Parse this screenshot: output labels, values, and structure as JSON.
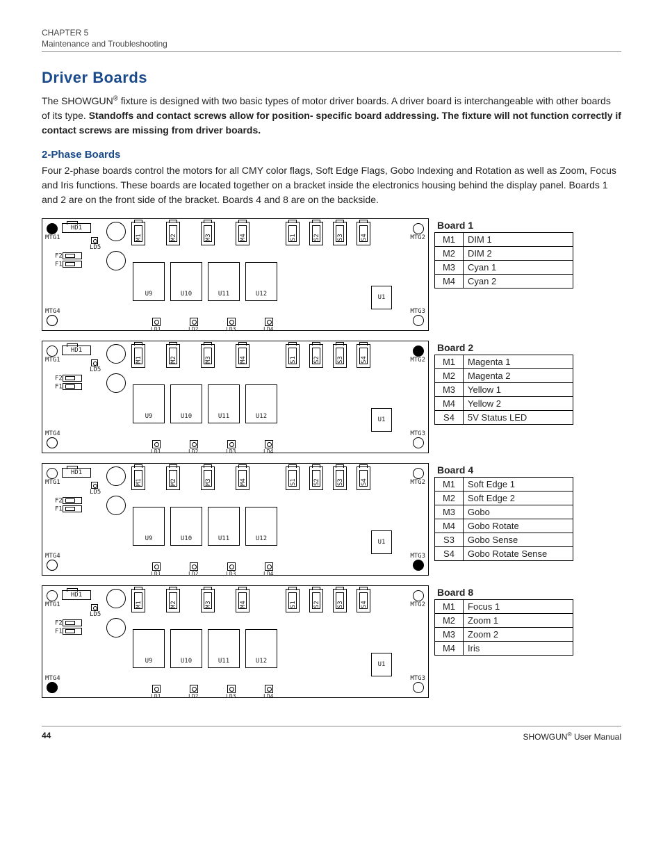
{
  "header": {
    "chapter": "CHAPTER 5",
    "section": "Maintenance and Troubleshooting"
  },
  "title": "Driver Boards",
  "para1_pre": "The SHOWGUN",
  "para1_sup": "®",
  "para1_mid": " fixture is designed with two basic types of motor driver boards. A driver board is interchangeable with other boards of its type. ",
  "para1_bold": "Standoffs and contact screws allow for position- specific board addressing. The fixture will not function correctly if contact screws are missing from driver boards.",
  "sub1": "2-Phase Boards",
  "para2": "Four 2-phase boards control the motors for all CMY color flags, Soft Edge Flags, Gobo Indexing and Rotation as well as Zoom, Focus and Iris functions. These boards are located together on a bracket inside the electronics housing behind the display panel. Boards 1 and 2 are on the front side of the bracket. Boards 4 and 8 are on the backside.",
  "diagram_labels": {
    "HD1": "HD1",
    "MTG1": "MTG1",
    "MTG2": "MTG2",
    "MTG3": "MTG3",
    "MTG4": "MTG4",
    "LD5": "LD5",
    "F2": "F2",
    "F1": "F1",
    "M1": "M1",
    "M2": "M2",
    "M3": "M3",
    "M4": "M4",
    "S1": "S1",
    "S2": "S2",
    "S3": "S3",
    "S4": "S4",
    "U9": "U9",
    "U10": "U10",
    "U11": "U11",
    "U12": "U12",
    "U1": "U1",
    "LD1": "LD1",
    "LD2": "LD2",
    "LD3": "LD3",
    "LD4": "LD4"
  },
  "boards": [
    {
      "title": "Board 1",
      "filled": [
        false,
        false,
        false,
        false
      ],
      "rows": [
        [
          "M1",
          "DIM 1"
        ],
        [
          "M2",
          "DIM 2"
        ],
        [
          "M3",
          "Cyan 1"
        ],
        [
          "M4",
          "Cyan 2"
        ]
      ]
    },
    {
      "title": "Board 2",
      "filled": [
        false,
        true,
        false,
        false
      ],
      "rows": [
        [
          "M1",
          "Magenta 1"
        ],
        [
          "M2",
          "Magenta 2"
        ],
        [
          "M3",
          "Yellow 1"
        ],
        [
          "M4",
          "Yellow 2"
        ],
        [
          "S4",
          "5V Status LED"
        ]
      ]
    },
    {
      "title": "Board 4",
      "filled": [
        false,
        false,
        true,
        false
      ],
      "rows": [
        [
          "M1",
          "Soft Edge 1"
        ],
        [
          "M2",
          "Soft Edge 2"
        ],
        [
          "M3",
          "Gobo"
        ],
        [
          "M4",
          "Gobo Rotate"
        ],
        [
          "S3",
          "Gobo Sense"
        ],
        [
          "S4",
          "Gobo Rotate Sense"
        ]
      ]
    },
    {
      "title": "Board 8",
      "filled": [
        false,
        false,
        false,
        true
      ],
      "rows": [
        [
          "M1",
          "Focus 1"
        ],
        [
          "M2",
          "Zoom 1"
        ],
        [
          "M3",
          "Zoom 2"
        ],
        [
          "M4",
          "Iris"
        ]
      ]
    }
  ],
  "footer": {
    "page": "44",
    "doc_pre": "SHOWGUN",
    "doc_sup": "®",
    "doc_post": " User Manual"
  }
}
